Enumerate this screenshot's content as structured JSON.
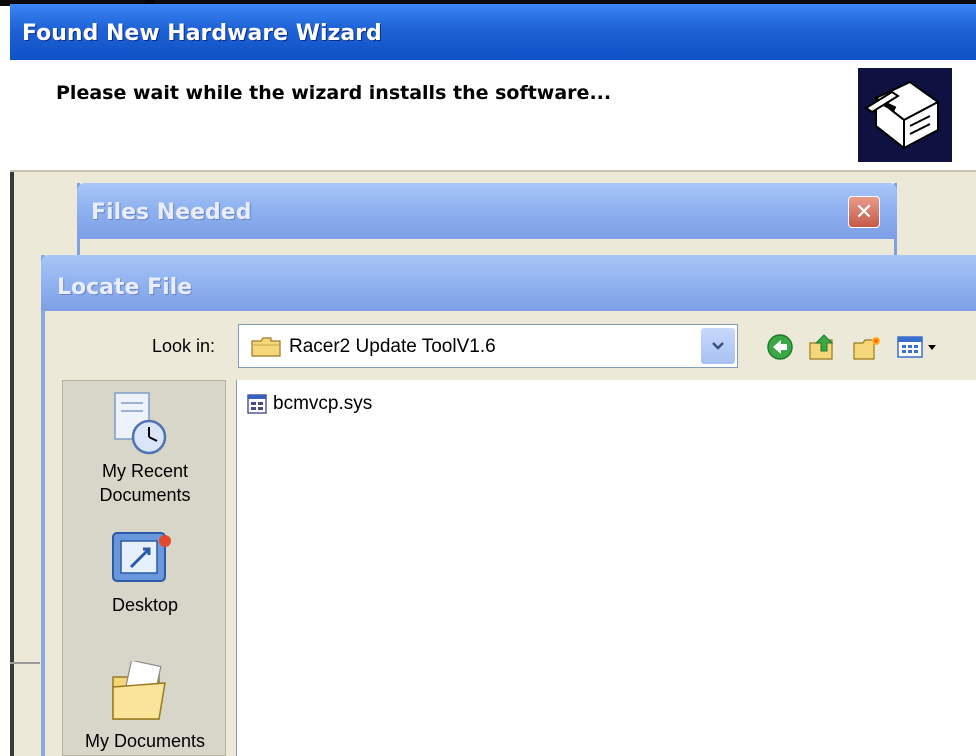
{
  "wizard": {
    "title": "Found New Hardware Wizard",
    "message": "Please wait while the wizard installs the software...",
    "icon": "hardware-install-icon"
  },
  "files_needed": {
    "title": "Files Needed",
    "close_icon": "close-icon"
  },
  "locate_file": {
    "title": "Locate File",
    "look_in_label": "Look in:",
    "look_in_value": "Racer2 Update ToolV1.6",
    "toolbar": [
      "back-icon",
      "up-folder-icon",
      "new-folder-icon",
      "view-menu-icon"
    ],
    "places": [
      {
        "label_line1": "My Recent",
        "label_line2": "Documents",
        "icon": "recent-documents-icon"
      },
      {
        "label_line1": "Desktop",
        "icon": "desktop-icon"
      },
      {
        "label_line1": "My Documents",
        "icon": "my-documents-icon"
      }
    ],
    "files": [
      {
        "name": "bcmvcp.sys",
        "icon": "system-file-icon"
      }
    ]
  }
}
